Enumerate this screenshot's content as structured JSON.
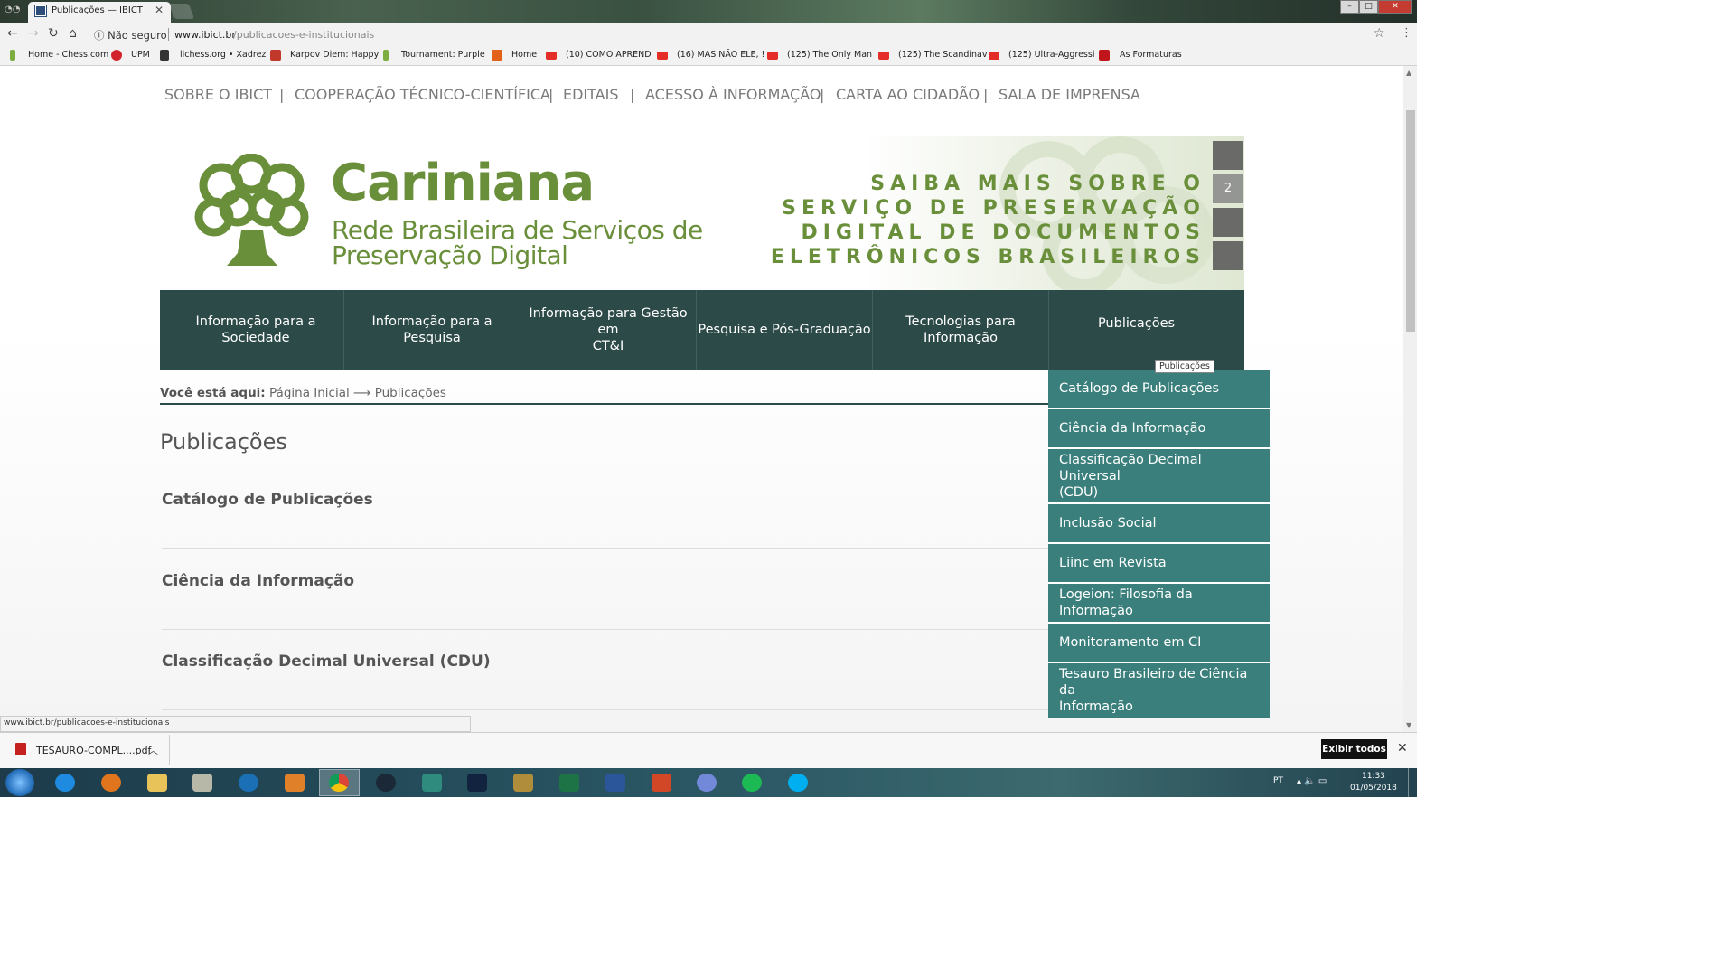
{
  "browser": {
    "tab_title": "Publicações — IBICT",
    "secure_label": "Não seguro",
    "url_host": "www.ibict.br",
    "url_path": "/publicacoes-e-institucionais",
    "bookmarks": [
      "Home - Chess.com",
      "UPM",
      "lichess.org • Xadrez",
      "Karpov Diem: Happy",
      "Tournament: Purple",
      "Home",
      "(10) COMO APREND",
      "(16) MAS NÃO ELE, !",
      "(125) The Only Man",
      "(125) The Scandinav",
      "(125) Ultra-Aggressi",
      "As Formaturas"
    ]
  },
  "top_links": [
    "SOBRE O IBICT",
    "COOPERAÇÃO TÉCNICO-CIENTÍFICA",
    "EDITAIS",
    "ACESSO À INFORMAÇÃO",
    "CARTA AO CIDADÃO",
    "SALA DE IMPRENSA"
  ],
  "top_sep": "|",
  "banner": {
    "title": "Cariniana",
    "subtitle_1": "Rede Brasileira  de Serviços de",
    "subtitle_2": "Preservação Digital",
    "promo": [
      "SAIBA MAIS SOBRE O",
      "SERVIÇO DE PRESERVAÇÃO",
      "DIGITAL DE DOCUMENTOS",
      "ELETRÔNICOS BRASILEIROS"
    ],
    "slides": [
      "",
      "2",
      "",
      ""
    ]
  },
  "main_nav": [
    {
      "l1": "Informação para a",
      "l2": "Sociedade"
    },
    {
      "l1": "Informação para a Pesquisa",
      "l2": ""
    },
    {
      "l1": "Informação para Gestão em",
      "l2": "CT&I"
    },
    {
      "l1": "Pesquisa e Pós-Graduação",
      "l2": ""
    },
    {
      "l1": "Tecnologias para",
      "l2": "Informação"
    },
    {
      "l1": "Publicações",
      "l2": ""
    }
  ],
  "breadcrumb": {
    "label": "Você está aqui:",
    "home": "Página Inicial",
    "arrow": "⟶",
    "current": "Publicações"
  },
  "page_title": "Publicações",
  "entries": [
    "Catálogo de Publicações",
    "Ciência da Informação",
    "Classificação Decimal Universal (CDU)"
  ],
  "tooltip": "Publicações",
  "dropdown": [
    {
      "l1": "Catálogo de Publicações",
      "l2": ""
    },
    {
      "l1": "Ciência da Informação",
      "l2": ""
    },
    {
      "l1": "Classificação Decimal Universal",
      "l2": "(CDU)"
    },
    {
      "l1": "Inclusão Social",
      "l2": ""
    },
    {
      "l1": "Liinc em Revista",
      "l2": ""
    },
    {
      "l1": "Logeion: Filosofia da Informação",
      "l2": ""
    },
    {
      "l1": "Monitoramento em CI",
      "l2": ""
    },
    {
      "l1": "Tesauro Brasileiro de Ciência da",
      "l2": "Informação"
    }
  ],
  "status_url": "www.ibict.br/publicacoes-e-institucionais",
  "download": {
    "file": "TESAURO-COMPL....pdf",
    "show_all": "Exibir todos"
  },
  "taskbar": {
    "lang": "PT",
    "time": "11:33",
    "date": "01/05/2018"
  },
  "colors": {
    "nav_bg": "#2c4a48",
    "dropdown_bg": "#3a7f7b",
    "brand_green": "#6a8f3a"
  }
}
